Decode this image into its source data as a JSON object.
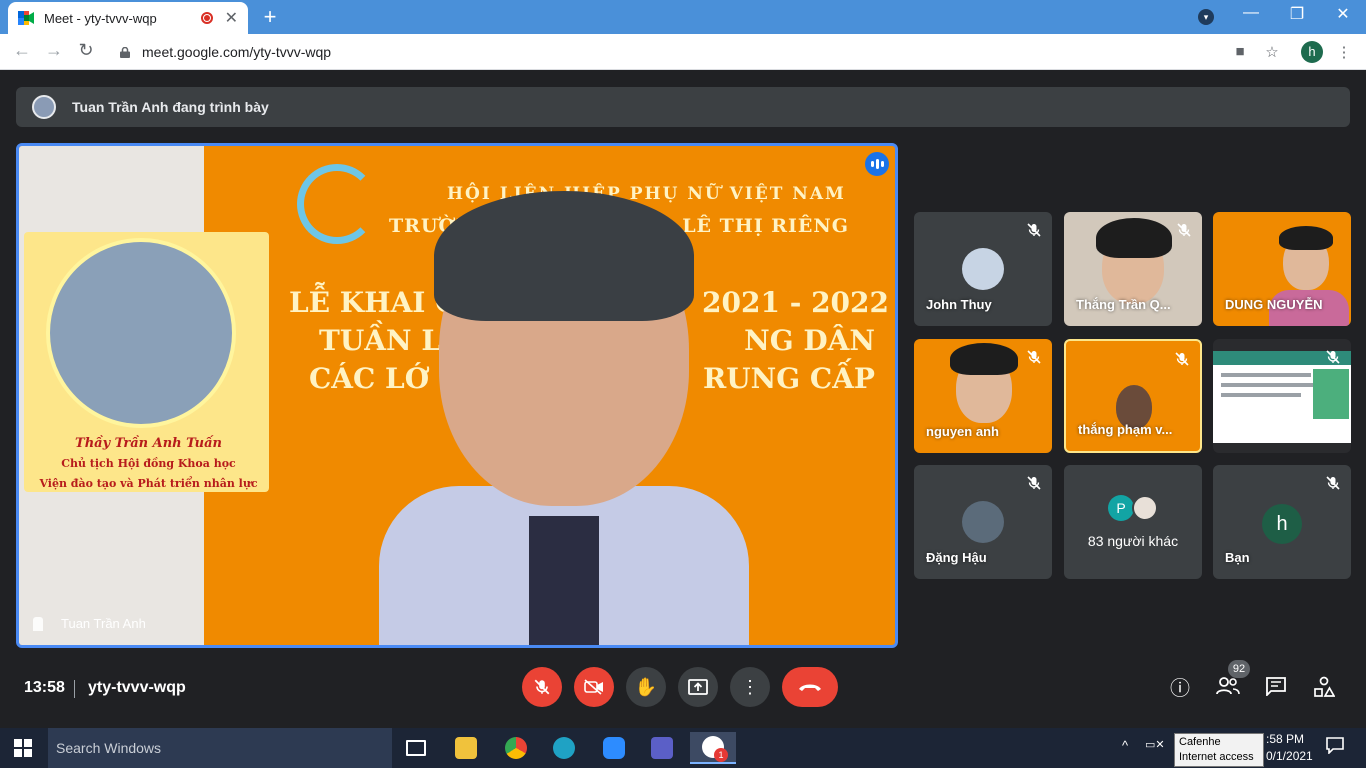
{
  "browser": {
    "tab_title": "Meet - yty-tvvv-wqp",
    "url": "meet.google.com/yty-tvvv-wqp",
    "profile_letter": "h"
  },
  "banner": {
    "text": "Tuan Trần Anh đang trình bày"
  },
  "presentation": {
    "org_line1": "HỘI LIÊN HIỆP PHỤ NỮ VIỆT NAM",
    "org_line2_left": "TRƯỜNG",
    "org_line2_right": "LÊ THỊ RIÊNG",
    "headline_line1_left": "LỄ KHAI G",
    "headline_line1_right": "2021 - 2022",
    "headline_line2_left": "TUẦN L",
    "headline_line2_right": "NG DÂN",
    "headline_line3_left": "CÁC LỚ",
    "headline_line3_right": "RUNG CẤP",
    "card_name": "Thầy Trần Anh Tuấn",
    "card_role1": "Chủ tịch Hội đồng Khoa học",
    "card_role2": "Viện đào tạo và Phát triển nhân lực",
    "presenter_name": "Tuan Trần Anh"
  },
  "participants": [
    {
      "name": "John Thuy"
    },
    {
      "name": "Thắng Trần Q..."
    },
    {
      "name": "DUNG NGUYỄN"
    },
    {
      "name": "nguyen anh"
    },
    {
      "name": "thắng phạm v..."
    },
    {
      "name": ""
    },
    {
      "name": "Đặng Hậu"
    },
    {
      "name": "83 người khác",
      "avatar_letter": "P"
    },
    {
      "name": "Bạn",
      "avatar_letter": "h"
    }
  ],
  "bottom": {
    "time": "13:58",
    "meeting_code": "yty-tvvv-wqp",
    "participant_count": "92"
  },
  "taskbar": {
    "search_placeholder": "Search Windows",
    "tooltip_line1": "Cafenhe",
    "tooltip_line2": "Internet access",
    "time": ":58 PM",
    "date": "0/1/2021",
    "notification_count": "1"
  },
  "colors": {
    "accent": "#1a73e8",
    "danger": "#ea4335",
    "slide_bg": "#f08a00"
  }
}
